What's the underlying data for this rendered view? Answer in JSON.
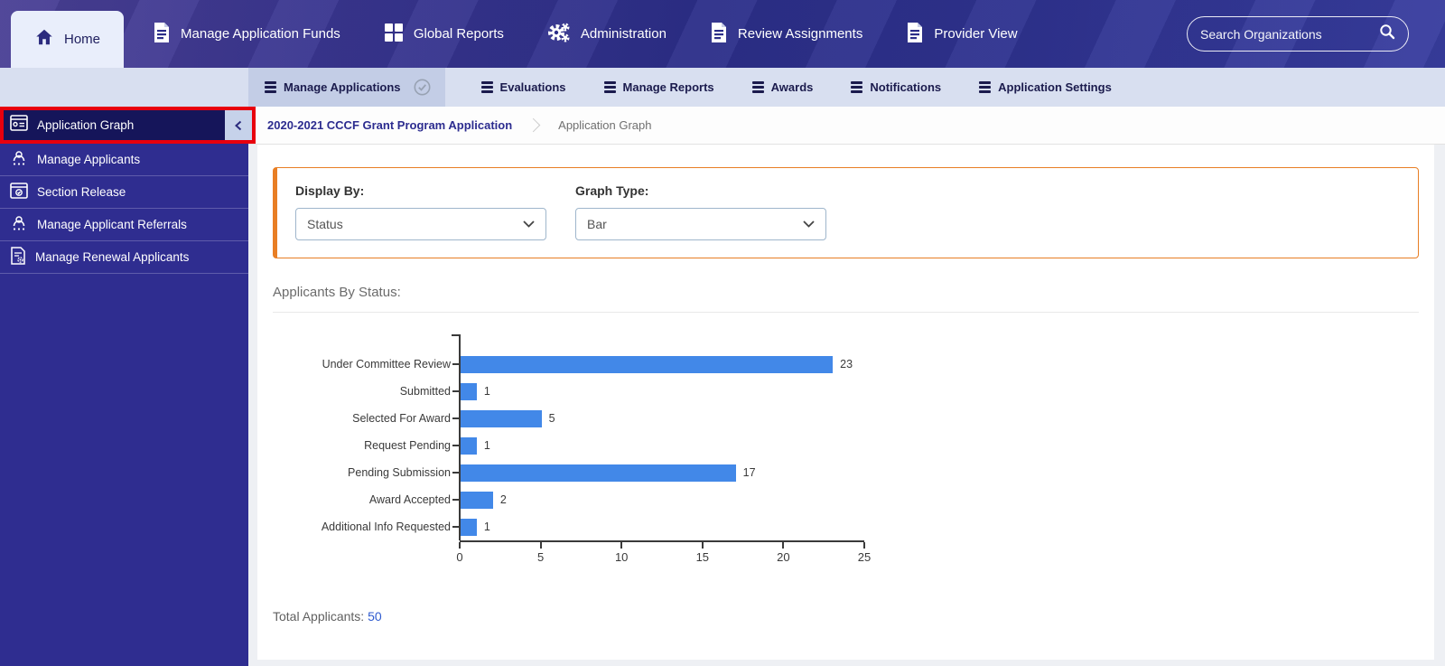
{
  "topnav": {
    "home_label": "Home",
    "items": [
      {
        "label": "Manage Application Funds"
      },
      {
        "label": "Global Reports"
      },
      {
        "label": "Administration"
      },
      {
        "label": "Review Assignments"
      },
      {
        "label": "Provider View"
      }
    ],
    "search_placeholder": "Search Organizations"
  },
  "subnav": {
    "active_label": "Manage Applications",
    "items": [
      {
        "label": "Evaluations"
      },
      {
        "label": "Manage Reports"
      },
      {
        "label": "Awards"
      },
      {
        "label": "Notifications"
      },
      {
        "label": "Application Settings"
      }
    ]
  },
  "breadcrumb": {
    "parent": "2020-2021 CCCF Grant Program Application",
    "current": "Application Graph"
  },
  "sidebar": {
    "items": [
      {
        "label": "Application Graph",
        "active": true,
        "icon": "application-graph-icon"
      },
      {
        "label": "Manage Applicants",
        "icon": "applicants-icon"
      },
      {
        "label": "Section Release",
        "icon": "section-release-icon"
      },
      {
        "label": "Manage Applicant Referrals",
        "icon": "referrals-icon"
      },
      {
        "label": "Manage Renewal Applicants",
        "icon": "renewal-icon"
      }
    ]
  },
  "filters": {
    "display_by_label": "Display By:",
    "display_by_value": "Status",
    "graph_type_label": "Graph Type:",
    "graph_type_value": "Bar"
  },
  "chart_data": {
    "type": "bar",
    "orientation": "horizontal",
    "title": "Applicants By Status:",
    "categories": [
      "Under Committee Review",
      "Submitted",
      "Selected For Award",
      "Request Pending",
      "Pending Submission",
      "Award Accepted",
      "Additional Info Requested"
    ],
    "values": [
      23,
      1,
      5,
      1,
      17,
      2,
      1
    ],
    "xticks": [
      0,
      5,
      10,
      15,
      20,
      25
    ],
    "xlim": [
      0,
      25
    ],
    "grid": false,
    "bar_color": "#4288e8"
  },
  "totals": {
    "label": "Total Applicants:",
    "value": "50"
  },
  "colors": {
    "bar_blue": "#4288e8",
    "accent_orange": "#e87e24",
    "annotation_red": "#e8000d",
    "sidebar_purple": "#2f2d90",
    "active_navy": "#15155a"
  }
}
